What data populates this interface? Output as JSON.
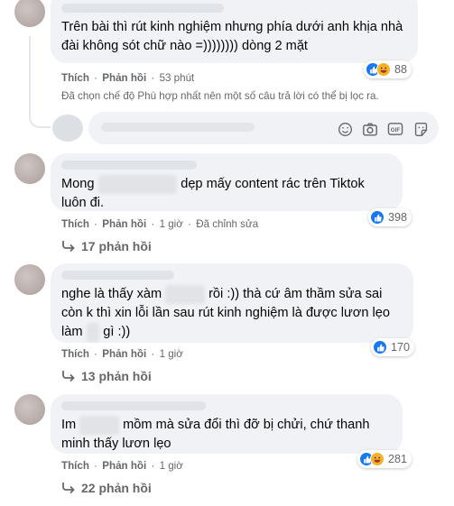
{
  "comments": [
    {
      "text": "Trên bài thì rút kinh nghiệm nhưng phía dưới anh khịa nhà đài không sót chữ nào =)))))))) dòng 2 mặt",
      "actions": {
        "like": "Thích",
        "reply": "Phản hồi",
        "time": "53 phút",
        "edited": ""
      },
      "reactions": {
        "types": [
          "like",
          "haha"
        ],
        "count": "88"
      },
      "replies": ""
    },
    {
      "text_before": "Mong",
      "text_hidden": "xxxxxxxxxxxx",
      "text_after": "dẹp mấy content rác trên Tiktok luôn đi.",
      "actions": {
        "like": "Thích",
        "reply": "Phản hồi",
        "time": "1 giờ",
        "edited": "Đã chỉnh sửa"
      },
      "reactions": {
        "types": [
          "like"
        ],
        "count": "398"
      },
      "replies": "17 phản hồi"
    },
    {
      "text_before": "nghe là thấy xàm",
      "text_hidden": "xxxxxx",
      "text_after": "rồi :)) thà cứ âm thầm sửa sai còn k thì xin lỗi lần sau rút kinh nghiệm là được lươn lẹo làm",
      "text_hidden2": "xx",
      "text_end": "gì :))",
      "actions": {
        "like": "Thích",
        "reply": "Phản hồi",
        "time": "1 giờ",
        "edited": ""
      },
      "reactions": {
        "types": [
          "like"
        ],
        "count": "170"
      },
      "replies": "13 phản hồi"
    },
    {
      "text_before": "Im",
      "text_hidden": "xxxxxx",
      "text_after": "mồm mà sửa đổi thì đỡ bị chửi, chứ thanh minh thấy lươn lẹo",
      "actions": {
        "like": "Thích",
        "reply": "Phản hồi",
        "time": "1 giờ",
        "edited": ""
      },
      "reactions": {
        "types": [
          "like",
          "haha"
        ],
        "count": "281"
      },
      "replies": "22 phản hồi"
    }
  ],
  "filter_notice": "Đã chọn chế độ Phù hợp nhất nên một số câu trả lời có thể bị lọc ra.",
  "separator": "·",
  "composer": {
    "icons": [
      "emoji-icon",
      "camera-icon",
      "gif-icon",
      "sticker-icon"
    ],
    "gif_label": "GIF"
  },
  "colors": {
    "like": "#1877f2",
    "haha": "#f7b125",
    "secondary_text": "#65676b",
    "bubble": "#f0f2f5"
  }
}
